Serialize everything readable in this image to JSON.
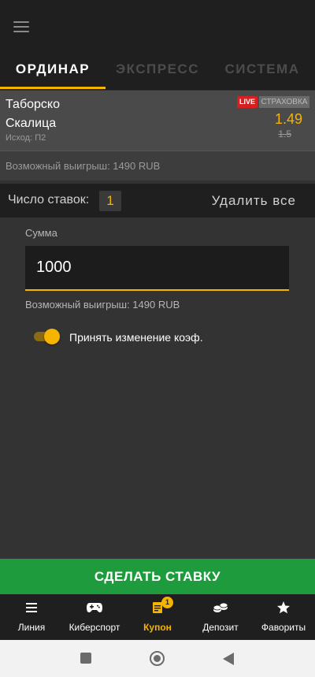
{
  "tabs": [
    {
      "label": "ОРДИНАР",
      "active": true
    },
    {
      "label": "ЭКСПРЕСС",
      "active": false
    },
    {
      "label": "СИСТЕМА",
      "active": false
    }
  ],
  "bet": {
    "team1": "Таборско",
    "team2": "Скалица",
    "outcome": "Исход: П2",
    "live_badge": "LIVE",
    "insurance_badge": "СТРАХОВКА",
    "odds_new": "1.49",
    "odds_old": "1.5",
    "possible_win": "Возможный выигрыш: 1490 RUB"
  },
  "count_bar": {
    "label": "Число ставок:",
    "count": "1",
    "delete_all": "Удалить все"
  },
  "form": {
    "sum_label": "Сумма",
    "sum_value": "1000",
    "possible_win": "Возможный выигрыш: 1490 RUB",
    "accept_changes_label": "Принять изменение коэф.",
    "accept_changes_on": true
  },
  "place_bet_label": "СДЕЛАТЬ СТАВКУ",
  "bottom_nav": [
    {
      "label": "Линия",
      "icon": "list-icon",
      "glyph": "☰"
    },
    {
      "label": "Киберспорт",
      "icon": "gamepad-icon",
      "glyph": "🎮"
    },
    {
      "label": "Купон",
      "icon": "coupon-icon",
      "glyph": "▤",
      "active": true,
      "badge": "1"
    },
    {
      "label": "Депозит",
      "icon": "coins-icon",
      "glyph": "⛁"
    },
    {
      "label": "Фавориты",
      "icon": "star-icon",
      "glyph": "★"
    }
  ],
  "colors": {
    "accent": "#f4b400",
    "live": "#d42020",
    "place_bet": "#1e9b3d",
    "background": "#333333"
  }
}
